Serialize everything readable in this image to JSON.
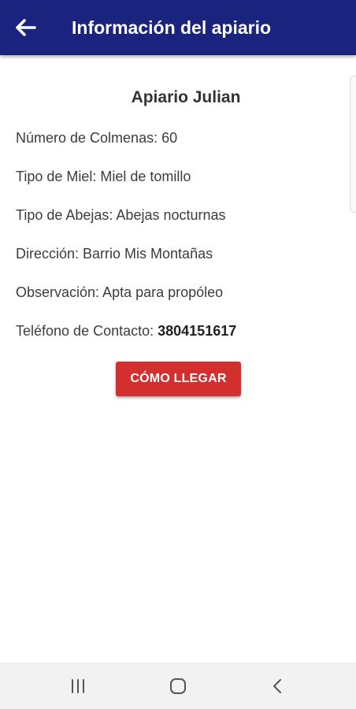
{
  "appbar": {
    "title": "Información del apiario",
    "back_icon": "arrow-left-icon",
    "background_color": "#1a237e"
  },
  "apiary": {
    "name": "Apiario Julian",
    "rows": [
      {
        "label": "Número de Colmenas: 60"
      },
      {
        "label": "Tipo de Miel: Miel de tomillo"
      },
      {
        "label": "Tipo de Abejas: Abejas nocturnas"
      },
      {
        "label": "Dirección: Barrio Mis Montañas"
      },
      {
        "label": "Observación: Apta para propóleo"
      }
    ],
    "phone": {
      "label": "Teléfono de Contacto: ",
      "value": "3804151617"
    }
  },
  "actions": {
    "directions_label": "CÓMO LLEGAR",
    "directions_color": "#d32f2f"
  },
  "system_nav": {
    "recents_icon": "recent-apps-icon",
    "home_icon": "home-icon",
    "back_icon": "back-chevron-icon"
  }
}
